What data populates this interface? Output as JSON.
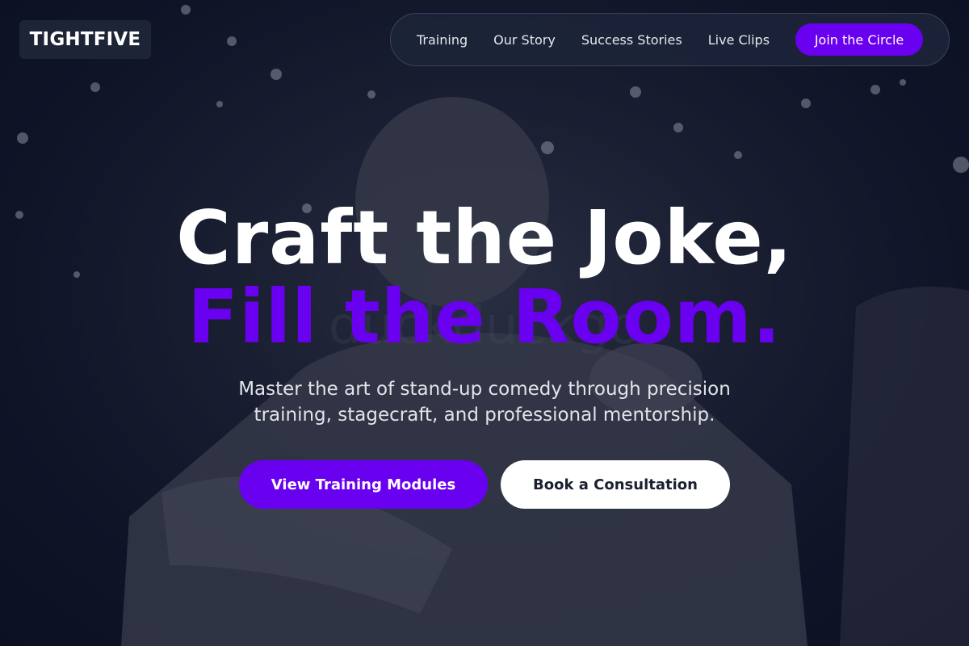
{
  "brand": {
    "logo_text": "TIGHTFIVE"
  },
  "nav": {
    "links": [
      "Training",
      "Our Story",
      "Success Stories",
      "Live Clips"
    ],
    "cta_label": "Join the Circle"
  },
  "hero": {
    "headline_line1": "Craft the Joke,",
    "headline_line2": "Fill the Room.",
    "subtext_line1": "Master the art of stand-up comedy through precision",
    "subtext_line2": "training, stagecraft, and professional mentorship.",
    "primary_button": "View Training Modules",
    "secondary_button": "Book a Consultation"
  },
  "colors": {
    "accent": "#6a00f0",
    "background": "#0d1124",
    "nav_background": "#1c2436",
    "text_light": "#ffffff"
  }
}
